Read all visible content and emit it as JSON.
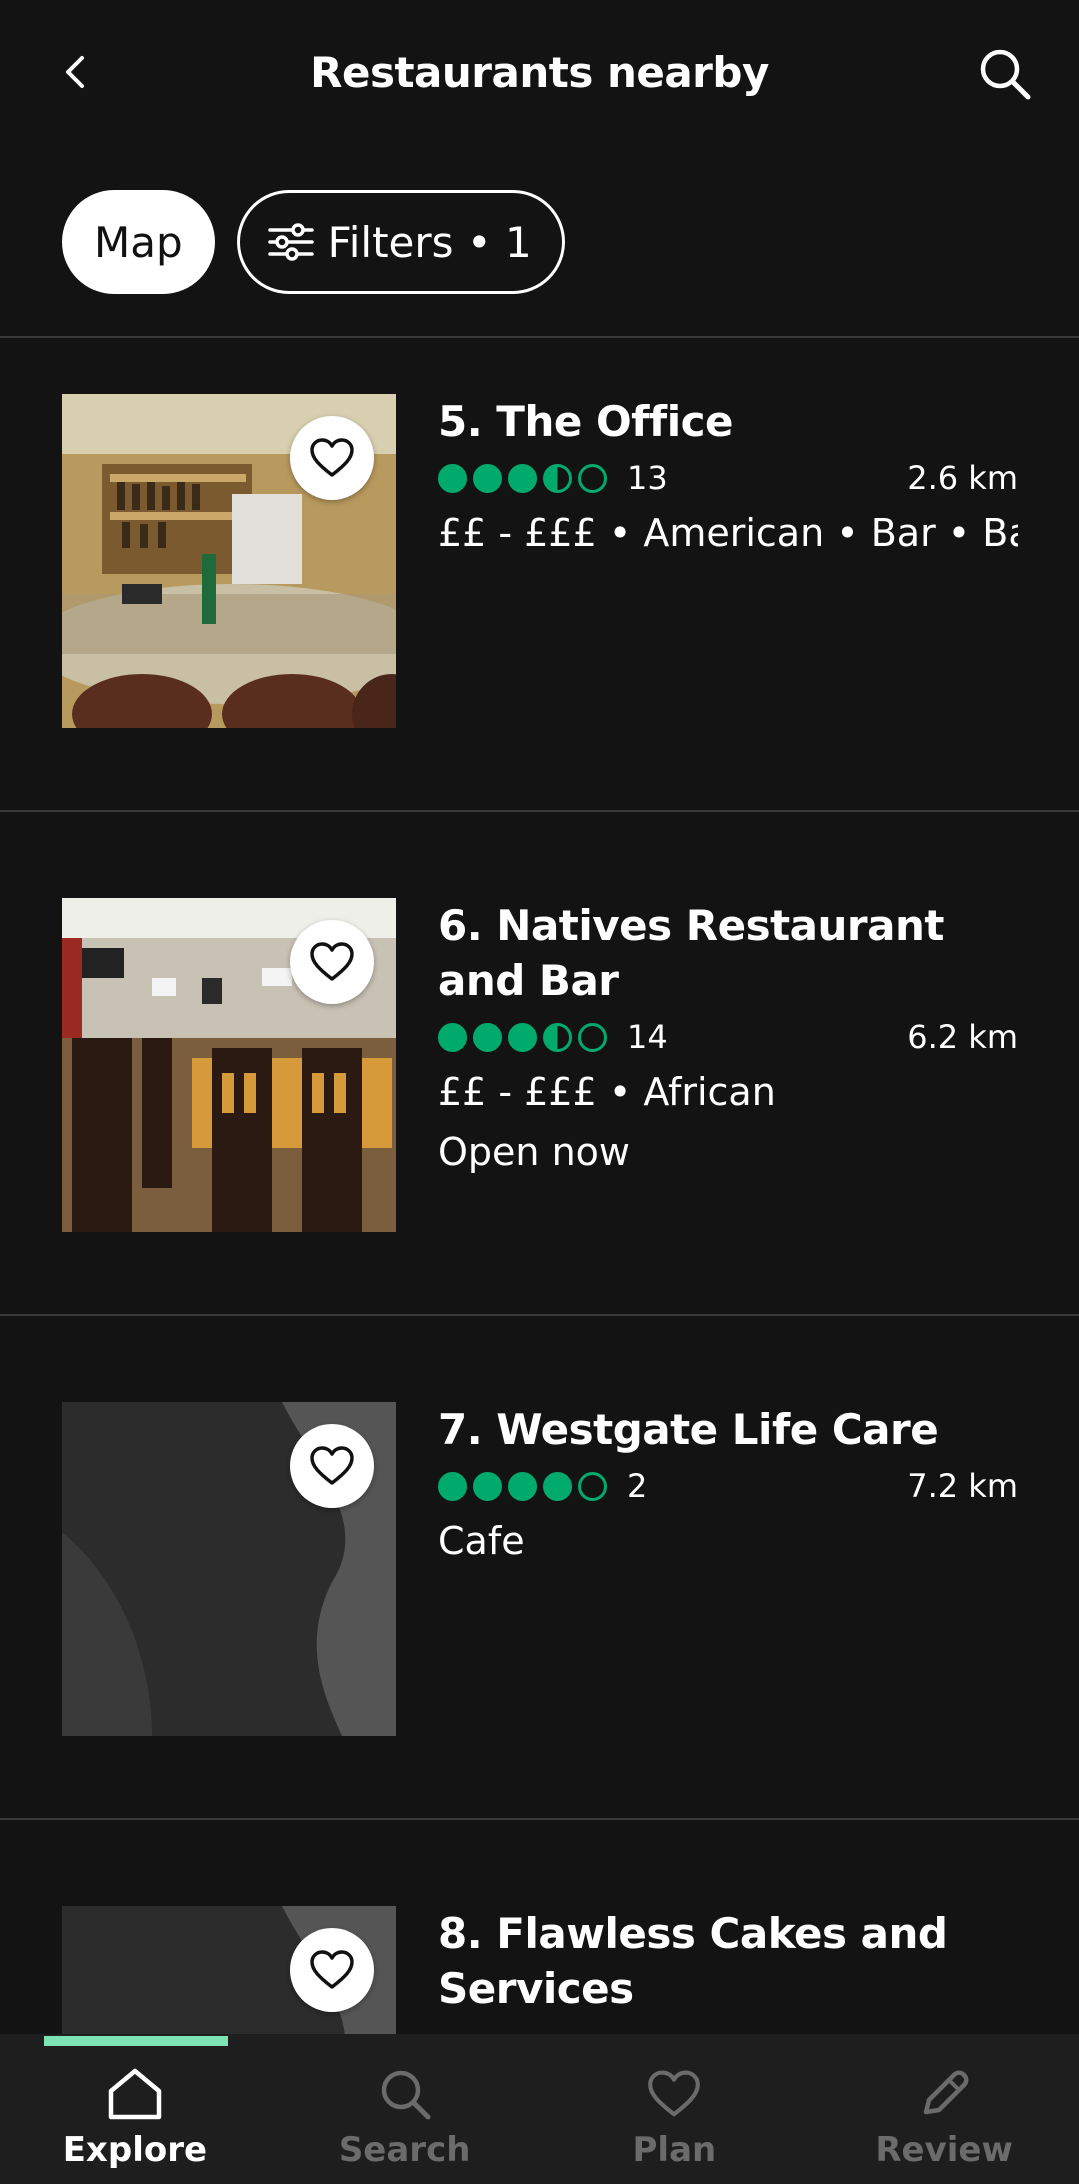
{
  "header": {
    "title": "Restaurants nearby",
    "back_icon": "chevron-left-icon",
    "search_icon": "search-icon"
  },
  "chips": {
    "map_label": "Map",
    "filters_label": "Filters • 1",
    "filters_icon": "sliders-icon"
  },
  "colors": {
    "background": "#131313",
    "rating_green": "#00aa6c",
    "nav_indicator": "#7de3b4"
  },
  "listings": [
    {
      "name": "5. The Office",
      "rating": 3.5,
      "review_count": "13",
      "distance": "2.6 km",
      "details": [
        "££ - £££ • American • Bar • Bar..."
      ],
      "image": "bar-interior-photo"
    },
    {
      "name": "6. Natives Restaurant and Bar",
      "rating": 3.5,
      "review_count": "14",
      "distance": "6.2 km",
      "details": [
        "££ - £££ • African",
        "Open now"
      ],
      "image": "dining-room-photo"
    },
    {
      "name": "7. Westgate Life Care",
      "rating": 4,
      "review_count": "2",
      "distance": "7.2 km",
      "details": [
        "Cafe"
      ],
      "image": "placeholder-image"
    },
    {
      "name": "8. Flawless Cakes and Services",
      "image": "placeholder-image"
    }
  ],
  "nav": {
    "items": [
      {
        "label": "Explore",
        "icon": "home-icon",
        "active": true
      },
      {
        "label": "Search",
        "icon": "search-icon",
        "active": false
      },
      {
        "label": "Plan",
        "icon": "heart-icon",
        "active": false
      },
      {
        "label": "Review",
        "icon": "pencil-icon",
        "active": false
      }
    ]
  }
}
